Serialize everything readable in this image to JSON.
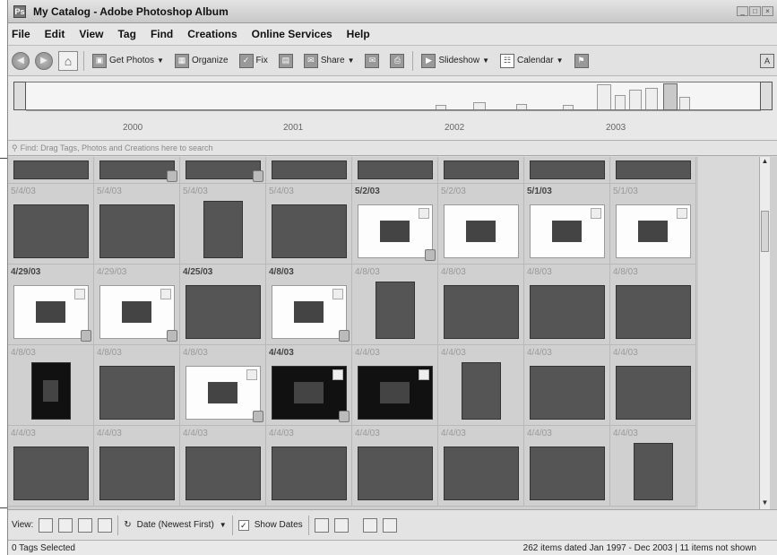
{
  "window": {
    "title": "My Catalog - Adobe Photoshop Album",
    "buttons": [
      "_",
      "□",
      "×"
    ]
  },
  "menu": [
    {
      "label": "File"
    },
    {
      "label": "Edit"
    },
    {
      "label": "View"
    },
    {
      "label": "Tag"
    },
    {
      "label": "Find"
    },
    {
      "label": "Creations"
    },
    {
      "label": "Online Services"
    },
    {
      "label": "Help"
    }
  ],
  "toolbar": {
    "get_photos": "Get Photos",
    "organize": "Organize",
    "fix": "Fix",
    "share": "Share",
    "slideshow": "Slideshow",
    "calendar": "Calendar"
  },
  "timeline": {
    "years": [
      "2000",
      "2001",
      "2002",
      "2003"
    ]
  },
  "findbar": {
    "text": "Find: Drag Tags, Photos and Creations here to search"
  },
  "grid": {
    "rows": [
      {
        "partial": true,
        "cells": [
          {
            "date": "",
            "type": "land"
          },
          {
            "date": "",
            "type": "land",
            "badge": true
          },
          {
            "date": "",
            "type": "land",
            "badge": true
          },
          {
            "date": "",
            "type": "land"
          },
          {
            "date": "",
            "type": "land"
          },
          {
            "date": "",
            "type": "land"
          },
          {
            "date": "",
            "type": "land"
          },
          {
            "date": "",
            "type": "land"
          }
        ]
      },
      {
        "cells": [
          {
            "date": "5/4/03",
            "bold": false,
            "type": "land"
          },
          {
            "date": "5/4/03",
            "bold": false,
            "type": "land"
          },
          {
            "date": "5/4/03",
            "bold": false,
            "type": "port"
          },
          {
            "date": "5/4/03",
            "bold": false,
            "type": "land"
          },
          {
            "date": "5/2/03",
            "bold": true,
            "type": "land",
            "style": "white",
            "badge": true,
            "corner": true
          },
          {
            "date": "5/2/03",
            "bold": false,
            "type": "land",
            "style": "white"
          },
          {
            "date": "5/1/03",
            "bold": true,
            "type": "land",
            "style": "white",
            "corner": true
          },
          {
            "date": "5/1/03",
            "bold": false,
            "type": "land",
            "style": "white",
            "corner": true
          }
        ]
      },
      {
        "cells": [
          {
            "date": "4/29/03",
            "bold": true,
            "type": "land",
            "style": "white",
            "badge": true,
            "corner": true
          },
          {
            "date": "4/29/03",
            "bold": false,
            "type": "land",
            "style": "white",
            "badge": true,
            "corner": true
          },
          {
            "date": "4/25/03",
            "bold": true,
            "type": "land"
          },
          {
            "date": "4/8/03",
            "bold": true,
            "type": "land",
            "style": "white",
            "badge": true,
            "corner": true
          },
          {
            "date": "4/8/03",
            "bold": false,
            "type": "port"
          },
          {
            "date": "4/8/03",
            "bold": false,
            "type": "land"
          },
          {
            "date": "4/8/03",
            "bold": false,
            "type": "land"
          },
          {
            "date": "4/8/03",
            "bold": false,
            "type": "land"
          }
        ]
      },
      {
        "cells": [
          {
            "date": "4/8/03",
            "bold": false,
            "type": "port",
            "style": "black"
          },
          {
            "date": "4/8/03",
            "bold": false,
            "type": "land"
          },
          {
            "date": "4/8/03",
            "bold": false,
            "type": "land",
            "style": "white",
            "badge": true,
            "corner": true
          },
          {
            "date": "4/4/03",
            "bold": true,
            "type": "land",
            "style": "black",
            "badge": true,
            "corner": true
          },
          {
            "date": "4/4/03",
            "bold": false,
            "type": "land",
            "style": "black",
            "corner": true
          },
          {
            "date": "4/4/03",
            "bold": false,
            "type": "port"
          },
          {
            "date": "4/4/03",
            "bold": false,
            "type": "land"
          },
          {
            "date": "4/4/03",
            "bold": false,
            "type": "land"
          }
        ]
      },
      {
        "cells": [
          {
            "date": "4/4/03",
            "bold": false,
            "type": "land"
          },
          {
            "date": "4/4/03",
            "bold": false,
            "type": "land"
          },
          {
            "date": "4/4/03",
            "bold": false,
            "type": "land"
          },
          {
            "date": "4/4/03",
            "bold": false,
            "type": "land"
          },
          {
            "date": "4/4/03",
            "bold": false,
            "type": "land"
          },
          {
            "date": "4/4/03",
            "bold": false,
            "type": "land"
          },
          {
            "date": "4/4/03",
            "bold": false,
            "type": "land"
          },
          {
            "date": "4/4/03",
            "bold": false,
            "type": "port"
          }
        ]
      }
    ]
  },
  "viewbar": {
    "view_label": "View:",
    "sort": "Date (Newest First)",
    "show_dates": "Show Dates"
  },
  "status": {
    "left": "0 Tags Selected",
    "right": "262 items dated Jan 1997 - Dec 2003 | 11 items not shown"
  }
}
